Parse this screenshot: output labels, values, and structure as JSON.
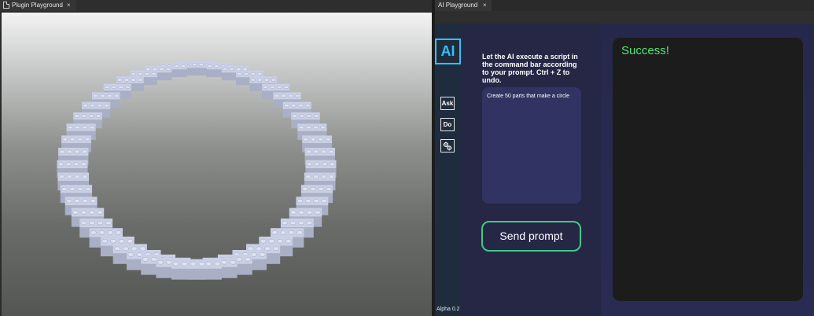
{
  "left_tab": {
    "label": "Plugin Playground",
    "close": "×",
    "icon": "file-icon"
  },
  "right_tab": {
    "label": "AI Playground",
    "close": "×"
  },
  "sidebar": {
    "logo": "AI",
    "ask_label": "Ask",
    "do_label": "Do",
    "settings_icon": "gears-icon",
    "version": "Alpha 0.2"
  },
  "prompt": {
    "instructions": "Let the AI execute a script in the command bar according to your prompt. Ctrl + Z to undo.",
    "text": "Create 50 parts that make a circle",
    "send_label": "Send prompt"
  },
  "output": {
    "text": "Success!"
  },
  "colors": {
    "accent_cyan": "#2fc3f5",
    "accent_green": "#40c98a",
    "success_text": "#55e37a",
    "panel_bg": "#252744",
    "sidebar_bg": "#1f2c3d",
    "prompt_box": "#313462",
    "brick": "#c9cfe4"
  },
  "viewport": {
    "scene": "ring of 50 studded bricks",
    "part_count": 50
  }
}
